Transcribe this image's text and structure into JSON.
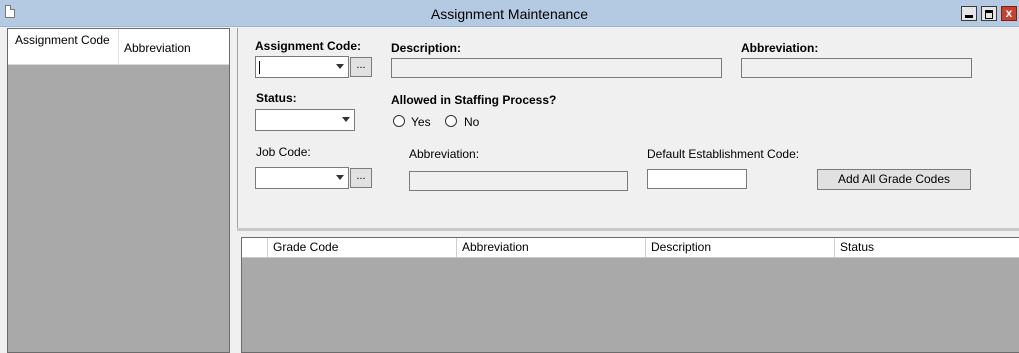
{
  "window": {
    "title": "Assignment Maintenance",
    "close_label": "x"
  },
  "left_list": {
    "columns": [
      "Assignment Code",
      "Abbreviation"
    ]
  },
  "form": {
    "assignment_code_label": "Assignment Code:",
    "assignment_code_value": "",
    "ellipsis_label": "...",
    "description_label": "Description:",
    "description_value": "",
    "abbreviation_label": "Abbreviation:",
    "abbreviation_value": "",
    "status_label": "Status:",
    "status_value": "",
    "allowed_label": "Allowed in Staffing Process?",
    "yes_label": "Yes",
    "no_label": "No",
    "job_code_label": "Job Code:",
    "job_code_value": "",
    "job_abbreviation_label": "Abbreviation:",
    "job_abbreviation_value": "",
    "default_establishment_label": "Default Establishment Code:",
    "default_establishment_value": "",
    "add_all_grade_codes_label": "Add All Grade Codes"
  },
  "grid": {
    "columns": [
      "Grade Code",
      "Abbreviation",
      "Description",
      "Status"
    ]
  }
}
